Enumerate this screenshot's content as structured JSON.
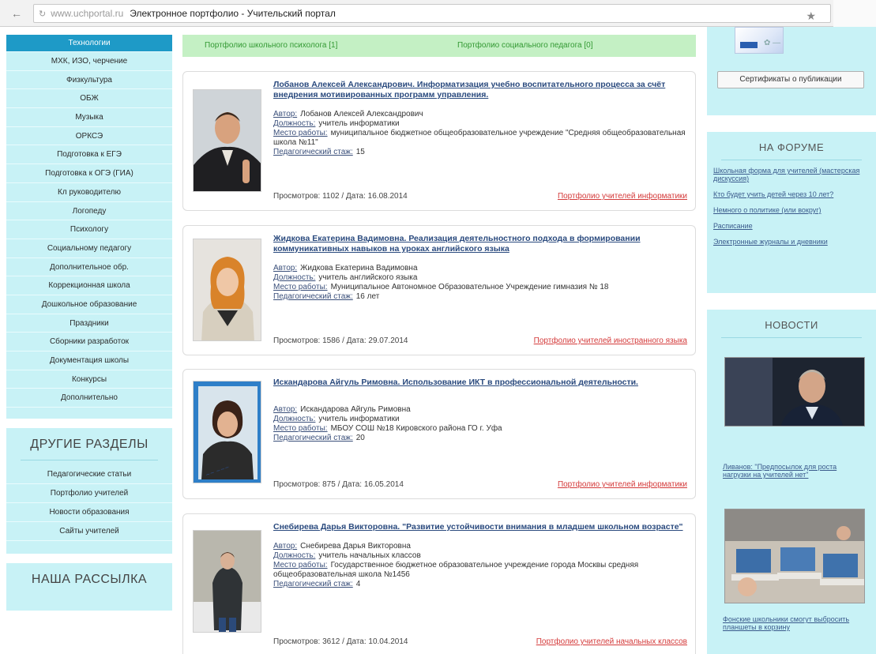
{
  "browser": {
    "url": "www.uchportal.ru",
    "page_title": "Электронное портфолио - Учительский портал"
  },
  "sidebar": {
    "menu_items": [
      {
        "label": "Технологии",
        "active": true
      },
      {
        "label": "МХК, ИЗО, черчение"
      },
      {
        "label": "Физкультура"
      },
      {
        "label": "ОБЖ"
      },
      {
        "label": "Музыка"
      },
      {
        "label": "ОРКСЭ"
      },
      {
        "label": "Подготовка к ЕГЭ"
      },
      {
        "label": "Подготовка к ОГЭ (ГИА)"
      },
      {
        "label": "Кл руководителю"
      },
      {
        "label": "Логопеду"
      },
      {
        "label": "Психологу"
      },
      {
        "label": "Социальному педагогу"
      },
      {
        "label": "Дополнительное обр."
      },
      {
        "label": "Коррекционная школа"
      },
      {
        "label": "Дошкольное образование"
      },
      {
        "label": "Праздники"
      },
      {
        "label": "Сборники разработок"
      },
      {
        "label": "Документация школы"
      },
      {
        "label": "Конкурсы"
      },
      {
        "label": "Дополнительно"
      }
    ],
    "other_sections": {
      "heading": "ДРУГИЕ РАЗДЕЛЫ",
      "items": [
        "Педагогические статьи",
        "Портфолио учителей",
        "Новости образования",
        "Сайты учителей"
      ]
    },
    "newsletter": {
      "heading": "НАША РАССЫЛКА"
    }
  },
  "tabs": {
    "psychologist": "Портфолио школьного психолога [1]",
    "social_teacher": "Портфолио социального педагога [0]"
  },
  "labels": {
    "author": "Автор:",
    "position": "Должность:",
    "workplace": "Место работы:",
    "experience": "Педагогический стаж:",
    "views_prefix": "Просмотров:",
    "date_prefix": "Дата:"
  },
  "portfolios": [
    {
      "title": "Лобанов Алексей Александрович. Информатизация учебно воспитательного процесса за счёт внедрения мотивированных программ управления.",
      "author": "Лобанов Алексей Александрович",
      "position": "учитель информатики",
      "workplace": "муниципальное бюджетное общеобразовательное учреждение \"Средняя общеобразовательная школа №11\"",
      "experience": "15",
      "views": "1102",
      "date": "16.08.2014",
      "category": "Портфолио учителей информатики"
    },
    {
      "title": "Жидкова Екатерина Вадимовна. Реализация деятельностного подхода в формировании коммуникативных навыков на уроках английского языка",
      "author": "Жидкова Екатерина Вадимовна",
      "position": "учитель английского языка",
      "workplace": "Муниципальное Автономное Образовательное Учреждение гимназия № 18",
      "experience": "16 лет",
      "views": "1586",
      "date": "29.07.2014",
      "category": "Портфолио учителей иностранного языка"
    },
    {
      "title": "Искандарова Айгуль Римовна. Использование ИКТ в профессиональной деятельности.",
      "author": "Искандарова Айгуль Римовна",
      "position": "учитель информатики",
      "workplace": "МБОУ СОШ №18 Кировского района ГО г. Уфа",
      "experience": "20",
      "views": "875",
      "date": "16.05.2014",
      "category": "Портфолио учителей информатики"
    },
    {
      "title": "Снебирева Дарья Викторовна. \"Развитие устойчивости внимания в младшем школьном возрасте\"",
      "author": "Снебирева Дарья Викторовна",
      "position": "учитель начальных классов",
      "workplace": "Государственное бюджетное образовательное учреждение города Москвы средняя общеобразовательная школа №1456",
      "experience": "4",
      "views": "3612",
      "date": "10.04.2014",
      "category": "Портфолио учителей начальных классов"
    }
  ],
  "right": {
    "cert_button": "Сертификаты о публикации",
    "forum": {
      "heading": "НА ФОРУМЕ",
      "links": [
        "Школьная форма для учителей (мастерская дискуссия)",
        "Кто будет учить детей через 10 лет?",
        "Немного о политике (или вокруг)",
        "Расписание",
        "Электронные журналы и дневники"
      ]
    },
    "news": {
      "heading": "НОВОСТИ",
      "items": [
        "Ливанов: \"Предпосылок для роста нагрузки на учителей нет\"",
        "Фонские школьники смогут выбросить планшеты в корзину"
      ]
    }
  },
  "colors": {
    "menu_bg": "#c8f2f6",
    "menu_active": "#1e9ac7",
    "tabs_bg": "#c4f0c4",
    "title_link": "#2a4a7e",
    "category_link": "#d43a3a"
  }
}
